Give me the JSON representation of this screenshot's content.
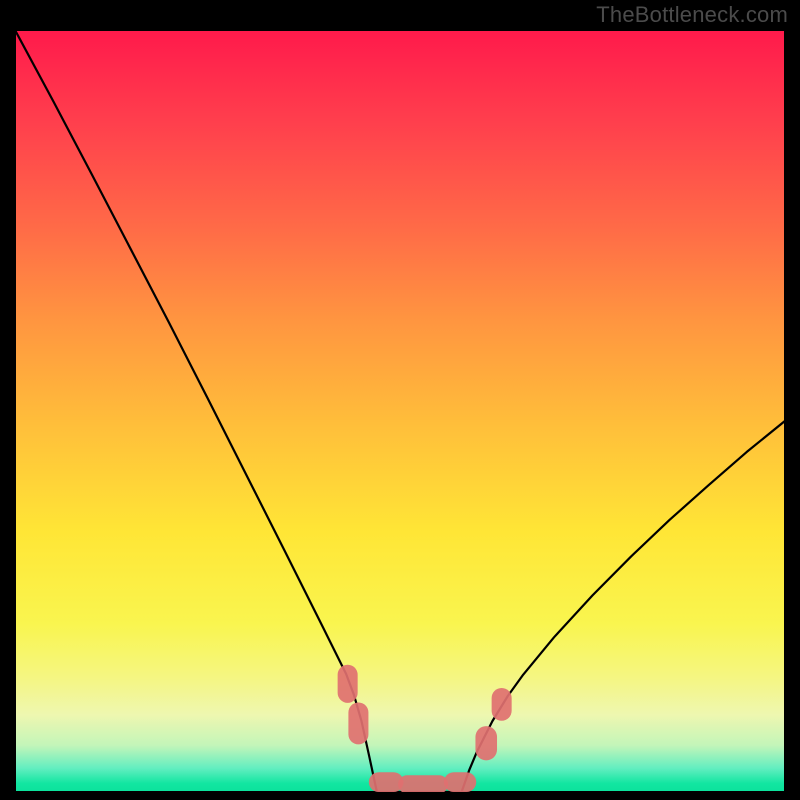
{
  "attribution": "TheBottleneck.com",
  "chart_data": {
    "type": "line",
    "title": "",
    "xlabel": "",
    "ylabel": "",
    "xlim": [
      0,
      100
    ],
    "ylim": [
      0,
      100
    ],
    "grid": false,
    "legend": false,
    "series": [
      {
        "name": "left-curve",
        "color": "#000000",
        "x": [
          0,
          5,
          10,
          15,
          20,
          25,
          30,
          35,
          40,
          43,
          44,
          45,
          46,
          47
        ],
        "y": [
          100,
          90.6,
          81.0,
          71.3,
          61.6,
          51.7,
          41.7,
          31.7,
          21.6,
          15.5,
          12.8,
          9.3,
          4.7,
          0
        ]
      },
      {
        "name": "valley-floor",
        "color": "#000000",
        "x": [
          47,
          58
        ],
        "y": [
          0,
          0
        ]
      },
      {
        "name": "right-curve",
        "color": "#000000",
        "x": [
          58,
          59,
          60,
          62,
          64,
          66,
          70,
          75,
          80,
          85,
          90,
          95,
          100
        ],
        "y": [
          0,
          2.9,
          5.3,
          9.3,
          12.6,
          15.4,
          20.3,
          25.8,
          30.9,
          35.7,
          40.2,
          44.6,
          48.7
        ]
      }
    ],
    "markers": [
      {
        "name": "left-cluster-upper",
        "shape": "rounded-rect",
        "color": "#e07070",
        "cx": 43.2,
        "cy": 14.2,
        "w": 2.6,
        "h": 5.0,
        "rot": 0
      },
      {
        "name": "left-cluster-lower",
        "shape": "rounded-rect",
        "color": "#e07070",
        "cx": 44.6,
        "cy": 9.0,
        "w": 2.6,
        "h": 5.5,
        "rot": 0
      },
      {
        "name": "valley-left",
        "shape": "rounded-rect",
        "color": "#e07070",
        "cx": 48.2,
        "cy": 1.3,
        "w": 4.5,
        "h": 2.6,
        "rot": 0
      },
      {
        "name": "valley-center",
        "shape": "rounded-rect",
        "color": "#e07070",
        "cx": 53.0,
        "cy": 1.0,
        "w": 6.5,
        "h": 2.4,
        "rot": 0
      },
      {
        "name": "valley-right",
        "shape": "rounded-rect",
        "color": "#e07070",
        "cx": 57.8,
        "cy": 1.3,
        "w": 4.2,
        "h": 2.6,
        "rot": 0
      },
      {
        "name": "right-cluster-lower",
        "shape": "rounded-rect",
        "color": "#e07070",
        "cx": 61.2,
        "cy": 6.4,
        "w": 2.8,
        "h": 4.5,
        "rot": 0
      },
      {
        "name": "right-cluster-upper",
        "shape": "rounded-rect",
        "color": "#e07070",
        "cx": 63.2,
        "cy": 11.5,
        "w": 2.6,
        "h": 4.3,
        "rot": 0
      }
    ],
    "background": {
      "type": "vertical-gradient",
      "stops": [
        {
          "pos": 0.0,
          "color": "#ff1a4b"
        },
        {
          "pos": 0.12,
          "color": "#ff3f4d"
        },
        {
          "pos": 0.26,
          "color": "#ff6b47"
        },
        {
          "pos": 0.38,
          "color": "#ff9540"
        },
        {
          "pos": 0.52,
          "color": "#ffbf3a"
        },
        {
          "pos": 0.66,
          "color": "#ffe636"
        },
        {
          "pos": 0.78,
          "color": "#f9f54f"
        },
        {
          "pos": 0.85,
          "color": "#f5f681"
        },
        {
          "pos": 0.9,
          "color": "#eef7b0"
        },
        {
          "pos": 0.94,
          "color": "#c3f5b9"
        },
        {
          "pos": 0.97,
          "color": "#63eec0"
        },
        {
          "pos": 0.99,
          "color": "#12e6a1"
        },
        {
          "pos": 1.0,
          "color": "#0ce29c"
        }
      ]
    }
  }
}
